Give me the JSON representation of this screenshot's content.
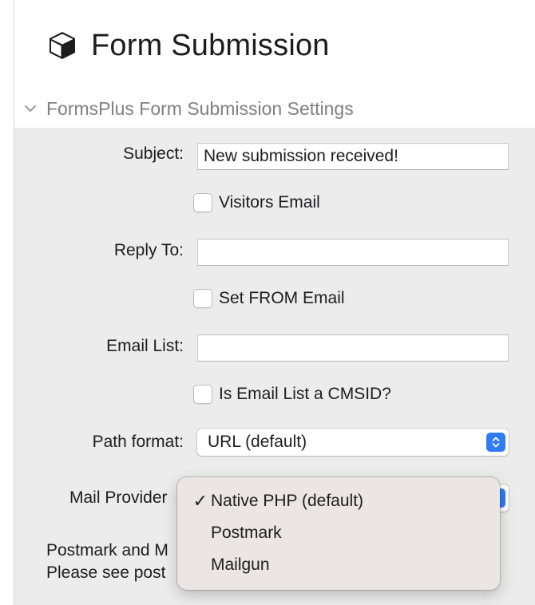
{
  "header": {
    "title": "Form Submission",
    "icon": "cube-icon"
  },
  "section": {
    "title": "FormsPlus Form Submission Settings",
    "expanded": true
  },
  "fields": {
    "subject_label": "Subject:",
    "subject_value": "New submission received!",
    "visitors_email_label": "Visitors Email",
    "visitors_email_checked": false,
    "reply_to_label": "Reply To:",
    "reply_to_value": "",
    "set_from_label": "Set FROM Email",
    "set_from_checked": false,
    "email_list_label": "Email List:",
    "email_list_value": "",
    "cmsid_label": "Is Email List a CMSID?",
    "cmsid_checked": false,
    "path_format_label": "Path format:",
    "path_format_value": "URL (default)",
    "mail_provider_label": "Mail Provider"
  },
  "note": {
    "line1": "Postmark and M",
    "line2": "Please see post"
  },
  "mail_provider_menu": {
    "items": [
      {
        "label": "Native PHP (default)",
        "checked": true,
        "check_glyph": "✓"
      },
      {
        "label": "Postmark",
        "checked": false,
        "check_glyph": ""
      },
      {
        "label": "Mailgun",
        "checked": false,
        "check_glyph": ""
      }
    ]
  },
  "colors": {
    "accent": "#2f7cf6",
    "panel": "#ececec",
    "menu": "#ebe5e3"
  }
}
